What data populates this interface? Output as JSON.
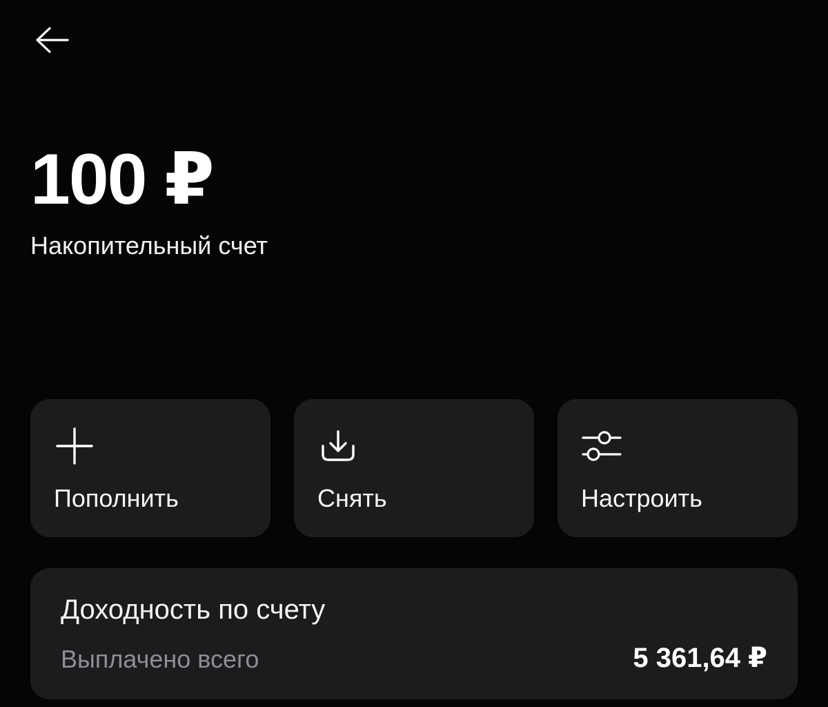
{
  "header": {
    "back_icon": "arrow-left-icon"
  },
  "account": {
    "balance": "100 ₽",
    "name": "Накопительный счет"
  },
  "actions": [
    {
      "label": "Пополнить",
      "icon": "plus-icon"
    },
    {
      "label": "Снять",
      "icon": "download-tray-icon"
    },
    {
      "label": "Настроить",
      "icon": "sliders-icon"
    }
  ],
  "yield": {
    "title": "Доходность по счету",
    "paid_label": "Выплачено всего",
    "paid_value": "5 361,64 ₽"
  },
  "colors": {
    "background": "#050505",
    "card": "#1c1c1e",
    "text_primary": "#ffffff",
    "text_secondary": "#8e8e93"
  }
}
